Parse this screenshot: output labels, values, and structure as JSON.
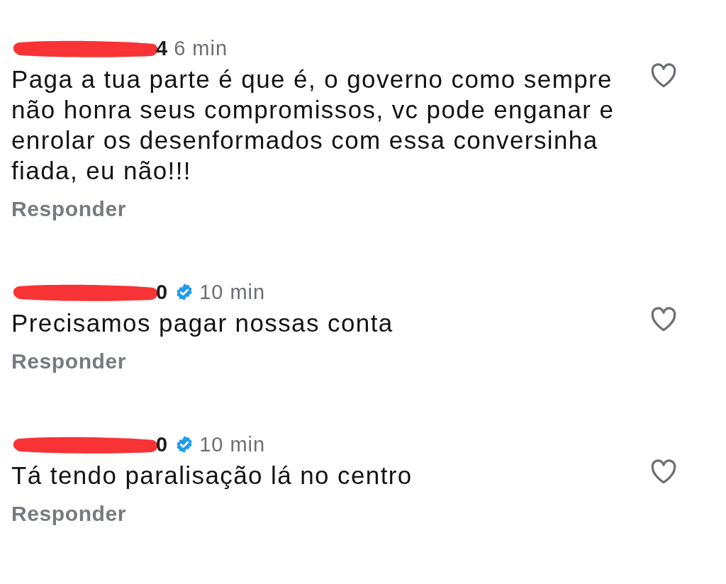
{
  "comments": [
    {
      "username_fragment": "4",
      "verified": false,
      "time": "6 min",
      "text": "Paga a tua parte é que é, o governo como sempre não honra seus compromissos, vc pode enganar e enrolar os desenformados com essa conversinha fiada, eu não!!!",
      "reply": "Responder",
      "liked": false
    },
    {
      "username_fragment": "0",
      "verified": true,
      "time": "10 min",
      "text": "Precisamos pagar nossas conta",
      "reply": "Responder",
      "liked": false
    },
    {
      "username_fragment": "0",
      "verified": true,
      "time": "10 min",
      "text": "Tá tendo paralisação lá no centro",
      "reply": "Responder",
      "liked": false
    }
  ]
}
